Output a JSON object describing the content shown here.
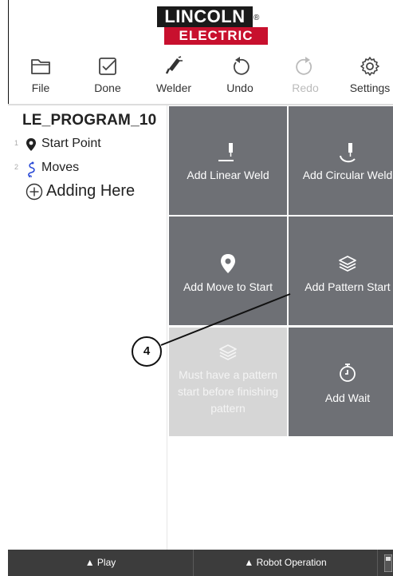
{
  "logo": {
    "line1": "LINCOLN",
    "line2": "ELECTRIC",
    "registered": "®"
  },
  "toolbar": [
    {
      "label": "File",
      "icon": "folder-icon",
      "enabled": true
    },
    {
      "label": "Done",
      "icon": "checkbox-icon",
      "enabled": true
    },
    {
      "label": "Welder",
      "icon": "welding-torch-icon",
      "enabled": true
    },
    {
      "label": "Undo",
      "icon": "undo-icon",
      "enabled": true
    },
    {
      "label": "Redo",
      "icon": "redo-icon",
      "enabled": false
    },
    {
      "label": "Settings",
      "icon": "gear-icon",
      "enabled": true
    }
  ],
  "program": {
    "name": "LE_PROGRAM_10",
    "items": [
      {
        "num": "1",
        "label": "Start Point",
        "icon": "location-pin-icon"
      },
      {
        "num": "2",
        "label": "Moves",
        "icon": "squiggle-path-icon"
      }
    ],
    "adding_here": "Adding Here"
  },
  "tiles": [
    {
      "label": "Add Linear Weld",
      "icon": "linear-weld-icon",
      "enabled": true
    },
    {
      "label": "Add Circular Weld",
      "icon": "circular-weld-icon",
      "enabled": true
    },
    {
      "label": "Add Move to Start",
      "icon": "location-pin-icon",
      "enabled": true
    },
    {
      "label": "Add Pattern Start",
      "icon": "layers-icon",
      "enabled": true
    },
    {
      "label": "Must have a pattern start before finishing pattern",
      "icon": "layers-icon",
      "enabled": false
    },
    {
      "label": "Add Wait",
      "icon": "stopwatch-icon",
      "enabled": true
    }
  ],
  "callout": "4",
  "bottom_bar": {
    "play": "▲ Play",
    "robot_operation": "▲ Robot Operation"
  },
  "colors": {
    "tile": "#6e7075",
    "tile_disabled": "#d6d6d6",
    "brand_red": "#c8102e",
    "bottom_bar": "#3c3c3c",
    "moves_icon": "#2b4bd6"
  }
}
